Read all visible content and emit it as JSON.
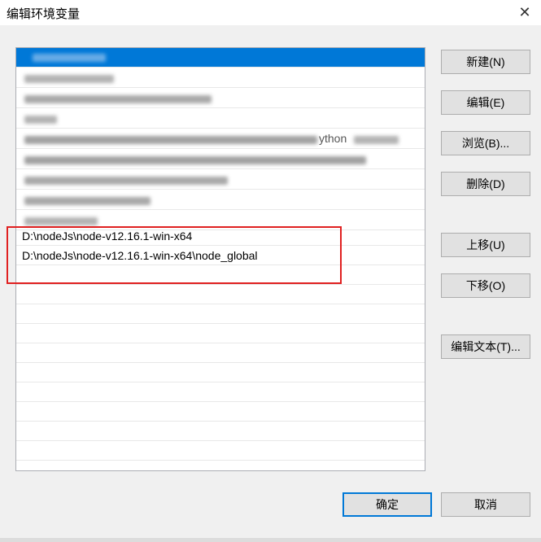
{
  "window": {
    "title": "编辑环境变量",
    "close_glyph": "✕"
  },
  "list": {
    "items": [
      {
        "text": "D:\\nodeJs\\node-v12.16.1-win-x64"
      },
      {
        "text": "D:\\nodeJs\\node-v12.16.1-win-x64\\node_global"
      }
    ],
    "partial_visible_text": "ython"
  },
  "buttons": {
    "new": "新建(N)",
    "edit": "编辑(E)",
    "browse": "浏览(B)...",
    "delete": "删除(D)",
    "move_up": "上移(U)",
    "move_down": "下移(O)",
    "edit_text": "编辑文本(T)...",
    "ok": "确定",
    "cancel": "取消"
  },
  "colors": {
    "selection": "#0078d7",
    "highlight_box": "#e02020",
    "dialog_background": "#f0f0f0"
  }
}
